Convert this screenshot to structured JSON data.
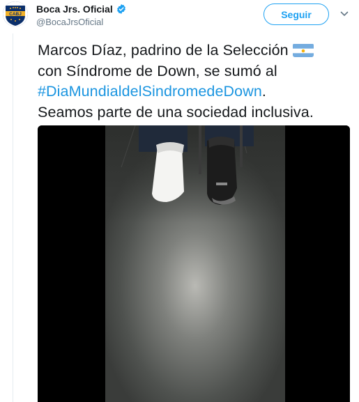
{
  "account": {
    "display_name": "Boca Jrs. Oficial",
    "handle": "@BocaJrsOficial",
    "avatar_text": "CABJ",
    "verified": true
  },
  "actions": {
    "follow_label": "Seguir"
  },
  "tweet": {
    "line1": "Marcos Díaz, padrino de la Selección",
    "line2": "con Síndrome de Down, se sumó al",
    "hashtag": "#DiaMundialdelSindromedeDown",
    "line3_tail": ".",
    "line4": "Seamos parte de una sociedad inclusiva."
  },
  "colors": {
    "link": "#1b95e0",
    "accent": "#1da1f2",
    "boca_blue": "#0b2f6b",
    "boca_gold": "#f3b229"
  },
  "icons": {
    "verified": "verified-badge-icon",
    "caret": "chevron-down-icon",
    "flag": "argentina-flag-icon"
  }
}
